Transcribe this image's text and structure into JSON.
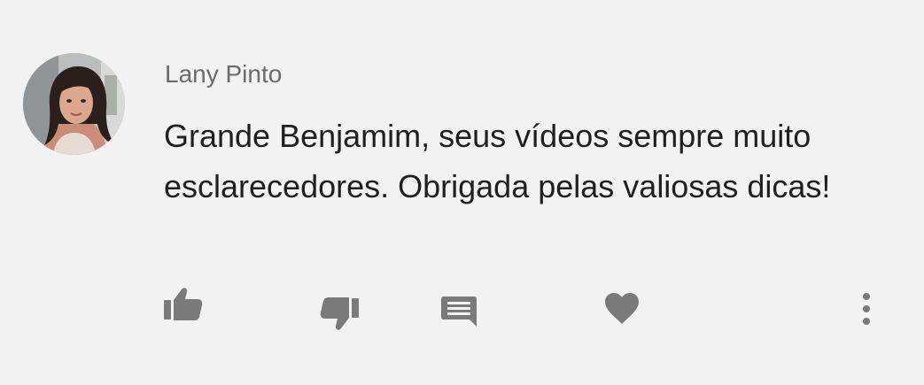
{
  "comment": {
    "author": "Lany Pinto",
    "text": "Grande Benjamim, seus vídeos sempre muito esclarecedores. Obrigada pelas valiosas dicas!",
    "avatar_icon": "user-avatar-photo"
  },
  "actions": {
    "like_icon": "thumbs-up-icon",
    "dislike_icon": "thumbs-down-icon",
    "reply_icon": "comment-icon",
    "heart_icon": "heart-icon",
    "more_icon": "more-vertical-icon",
    "icon_color": "#7a7a7a"
  }
}
